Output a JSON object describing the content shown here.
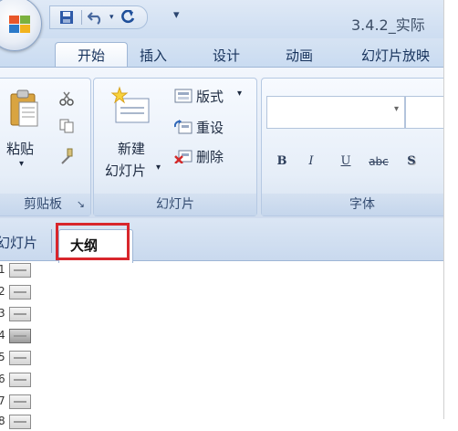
{
  "window": {
    "title": "3.4.2_实际"
  },
  "quick_access": {
    "save_icon": "save-icon",
    "undo_icon": "undo-icon",
    "redo_icon": "redo-icon",
    "customize_glyph": "▾"
  },
  "tabs": [
    {
      "label": "开始",
      "active": true
    },
    {
      "label": "插入"
    },
    {
      "label": "设计"
    },
    {
      "label": "动画"
    },
    {
      "label": "幻灯片放映"
    }
  ],
  "ribbon": {
    "clipboard": {
      "paste_label": "粘贴",
      "paste_arrow": "▾",
      "group_label": "剪贴板",
      "launcher": "↘"
    },
    "slides": {
      "new_slide_line1": "新建",
      "new_slide_line2": "幻灯片",
      "new_slide_arrow": "▾",
      "layout_label": "版式",
      "layout_arrow": "▾",
      "reset_label": "重设",
      "delete_label": "删除",
      "group_label": "幻灯片"
    },
    "font": {
      "group_label": "字体",
      "bold": "B",
      "italic": "I",
      "underline": "U",
      "strike": "abc",
      "shadow": "S",
      "dropdown_arrow": "▾"
    }
  },
  "view_tabs": {
    "slides_tab": "幻灯片",
    "outline_tab": "大纲"
  },
  "slide_list": {
    "count": 8,
    "selected_index": 3
  },
  "colors": {
    "highlight": "#d8262c",
    "ribbon_bg": "#dfe9f6",
    "tab_text": "#16325c"
  }
}
